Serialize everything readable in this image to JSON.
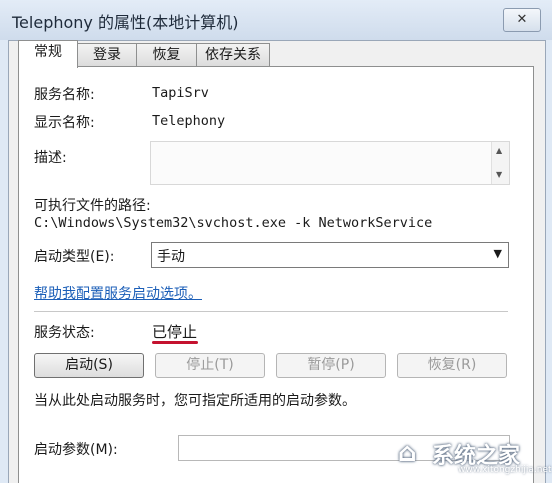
{
  "window": {
    "title": "Telephony 的属性(本地计算机)",
    "close_glyph": "✕"
  },
  "tabs": [
    {
      "label": "常规",
      "active": true
    },
    {
      "label": "登录"
    },
    {
      "label": "恢复"
    },
    {
      "label": "依存关系"
    }
  ],
  "general": {
    "service_name_label": "服务名称:",
    "service_name_value": "TapiSrv",
    "display_name_label": "显示名称:",
    "display_name_value": "Telephony",
    "description_label": "描述:",
    "path_label": "可执行文件的路径:",
    "path_value": "C:\\Windows\\System32\\svchost.exe -k NetworkService",
    "startup_type_label": "启动类型(E):",
    "startup_type_value": "手动",
    "help_link": "帮助我配置服务启动选项。",
    "status_label": "服务状态:",
    "status_value": "已停止",
    "buttons": {
      "start": "启动(S)",
      "stop": "停止(T)",
      "pause": "暂停(P)",
      "resume": "恢复(R)"
    },
    "hint": "当从此处启动服务时，您可指定所适用的启动参数。",
    "params_label": "启动参数(M):"
  },
  "watermark": {
    "text": "系统之家",
    "url": "www.xitongzhijia.net"
  },
  "colors": {
    "status_underline": "#c4122f",
    "link": "#1c5fb8"
  }
}
